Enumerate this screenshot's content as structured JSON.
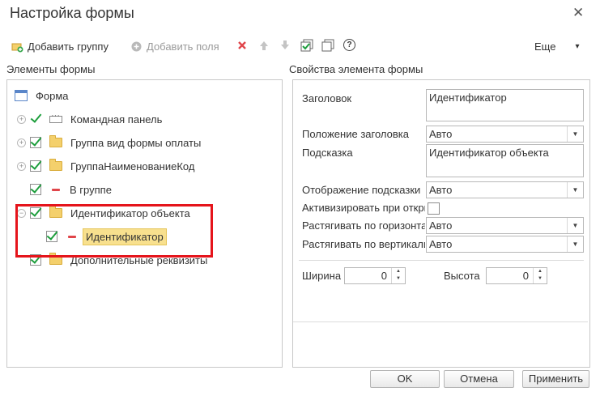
{
  "window": {
    "title": "Настройка формы",
    "close_glyph": "✕"
  },
  "toolbar": {
    "add_group": "Добавить группу",
    "add_fields": "Добавить поля",
    "more": "Еще",
    "more_arrow": "▾",
    "help_glyph": "?",
    "icons": [
      "add-group-icon",
      "add-fields-icon",
      "delete-icon",
      "move-up-icon",
      "move-down-icon",
      "check-all-icon",
      "copy-icon",
      "help-icon"
    ]
  },
  "left": {
    "label": "Элементы формы",
    "tree": {
      "root": "Форма",
      "items": [
        {
          "label": "Командная панель"
        },
        {
          "label": "Группа вид формы оплаты"
        },
        {
          "label": "ГруппаНаименованиеКод"
        },
        {
          "label": "В группе"
        },
        {
          "label": "Идентификатор объекта"
        },
        {
          "label": "Идентификатор"
        },
        {
          "label": "Дополнительные реквизиты"
        }
      ]
    }
  },
  "right": {
    "label": "Свойства элемента формы",
    "props": {
      "title_label": "Заголовок",
      "title_value": "Идентификатор",
      "title_pos_label": "Положение заголовка",
      "title_pos_value": "Авто",
      "hint_label": "Подсказка",
      "hint_value": "Идентификатор объекта",
      "hint_display_label": "Отображение подсказки",
      "hint_display_value": "Авто",
      "activate_label": "Активизировать при откры",
      "stretch_h_label": "Растягивать по горизонта",
      "stretch_h_value": "Авто",
      "stretch_v_label": "Растягивать по вертикали",
      "stretch_v_value": "Авто",
      "width_label": "Ширина",
      "width_value": "0",
      "height_label": "Высота",
      "height_value": "0"
    }
  },
  "footer": {
    "ok": "OK",
    "cancel": "Отмена",
    "apply": "Применить"
  },
  "colors": {
    "highlight": "#f8e08e",
    "annotation_box": "#e5141b",
    "check": "#1d9e3c"
  }
}
